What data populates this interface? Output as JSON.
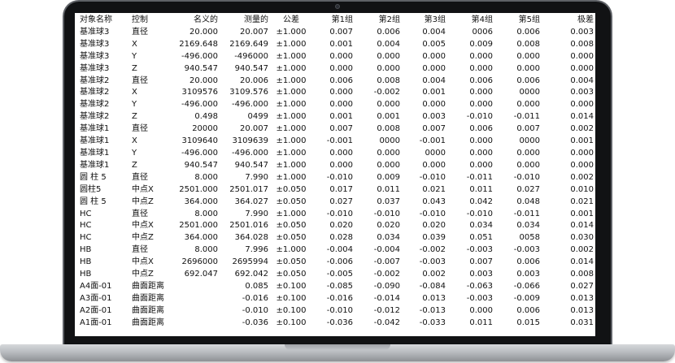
{
  "columns": [
    "对象名称",
    "控制",
    "名义的",
    "测量的",
    "公差",
    "第1组",
    "第2组",
    "第3组",
    "第4组",
    "第5组",
    "极差"
  ],
  "rows": [
    [
      "基准球3",
      "直径",
      "20.000",
      "20.007",
      "±1.000",
      "0.007",
      "0.006",
      "0.004",
      "0006",
      "0.006",
      "0.003"
    ],
    [
      "基准球3",
      "X",
      "2169.648",
      "2169.649",
      "±1.000",
      "0.001",
      "0.004",
      "0.005",
      "0.009",
      "0.008",
      "0.008"
    ],
    [
      "基准球3",
      "Y",
      "-496.000",
      "-496000",
      "±1.000",
      "0.000",
      "0.000",
      "0.000",
      "0.000",
      "0.000",
      "0.000"
    ],
    [
      "基准球3",
      "Z",
      "940.547",
      "940.547",
      "±1.000",
      "0.000",
      "0.000",
      "0.000",
      "0.000",
      "0.000",
      "0.000"
    ],
    [
      "基准球2",
      "直径",
      "20.000",
      "20.006",
      "±1.000",
      "0.006",
      "0.008",
      "0.004",
      "0.006",
      "0.006",
      "0.004"
    ],
    [
      "基准球2",
      "X",
      "3109576",
      "3109.576",
      "±1.000",
      "0.000",
      "-0.002",
      "0.001",
      "0.000",
      "0000",
      "0.003"
    ],
    [
      "基准球2",
      "Y",
      "-496.000",
      "-496.000",
      "±1.000",
      "0.000",
      "0.000",
      "0.000",
      "0.000",
      "0.000",
      "0.000"
    ],
    [
      "基准球2",
      "Z",
      "0.498",
      "0499",
      "±1.000",
      "0.001",
      "0.001",
      "0.003",
      "-0.010",
      "-0.011",
      "0.014"
    ],
    [
      "基准球1",
      "直径",
      "20000",
      "20.007",
      "±1.000",
      "0.007",
      "0.008",
      "0.007",
      "0.006",
      "0.007",
      "0.002"
    ],
    [
      "基准球1",
      "X",
      "3109640",
      "3109639",
      "±1.000",
      "-0.001",
      "0000",
      "-0.001",
      "0.000",
      "0000",
      "0.001"
    ],
    [
      "基准球1",
      "Y",
      "-496.000",
      "-496.000",
      "±1.000",
      "0.000",
      "0.000",
      "0000",
      "0.000",
      "0.000",
      "0.000"
    ],
    [
      "基准球1",
      "Z",
      "940.547",
      "940.547",
      "±1.000",
      "0.000",
      "0.000",
      "0.000",
      "0.000",
      "0.000",
      "0.000"
    ],
    [
      "圆 柱 5",
      "直径",
      "8.000",
      "7.990",
      "±1.000",
      "-0.010",
      "0.009",
      "-0.010",
      "-0.011",
      "-0.010",
      "0.002"
    ],
    [
      "圆柱5",
      "中点X",
      "2501.000",
      "2501.017",
      "±0.050",
      "0.017",
      "0.011",
      "0.021",
      "0.011",
      "0.027",
      "0.010"
    ],
    [
      "圆 柱 5",
      "中点Z",
      "364.000",
      "364.027",
      "±0.050",
      "0.027",
      "0.037",
      "0.043",
      "0.042",
      "0.048",
      "0.021"
    ],
    [
      "HC",
      "直径",
      "8.000",
      "7.990",
      "±1.000",
      "-0.010",
      "-0.010",
      "-0.010",
      "-0.010",
      "-0.011",
      "0.001"
    ],
    [
      "HC",
      "中点X",
      "2501.000",
      "2501.016",
      "±0.050",
      "0.020",
      "0.020",
      "0.020",
      "0.034",
      "0.034",
      "0.014"
    ],
    [
      "HC",
      "中点Z",
      "364.000",
      "364.028",
      "±0.050",
      "0.028",
      "0.034",
      "0.039",
      "0.051",
      "0058",
      "0.030"
    ],
    [
      "HB",
      "直径",
      "8.000",
      "7.996",
      "±1.000",
      "-0.004",
      "-0.004",
      "-0.002",
      "-0.003",
      "-0.003",
      "0.002"
    ],
    [
      "HB",
      "中点X",
      "2696000",
      "2695994",
      "±0.050",
      "-0.006",
      "-0.007",
      "-0.003",
      "0.007",
      "0.006",
      "0.014"
    ],
    [
      "HB",
      "中点Z",
      "692.047",
      "692.042",
      "±0.050",
      "-0.005",
      "-0.002",
      "0.002",
      "0.003",
      "0.003",
      "0.008"
    ],
    [
      "A4面-01",
      "曲面距离",
      "",
      "0.085",
      "±0.100",
      "-0.085",
      "-0.090",
      "-0.084",
      "-0.063",
      "-0.066",
      "0.027"
    ],
    [
      "A3面-01",
      "曲面距离",
      "",
      "-0.016",
      "±0.100",
      "-0.016",
      "-0.014",
      "0.013",
      "-0.003",
      "-0.009",
      "0.013"
    ],
    [
      "A2面-01",
      "曲面距离",
      "",
      "-0.010",
      "±0.100",
      "-0.010",
      "-0.012",
      "-0.013",
      "0.000",
      "0.006",
      "0.013"
    ],
    [
      "A1面-01",
      "曲面距离",
      "",
      "-0.036",
      "±0.100",
      "-0.036",
      "-0.042",
      "-0.033",
      "0.011",
      "0.015",
      "0.031"
    ]
  ]
}
